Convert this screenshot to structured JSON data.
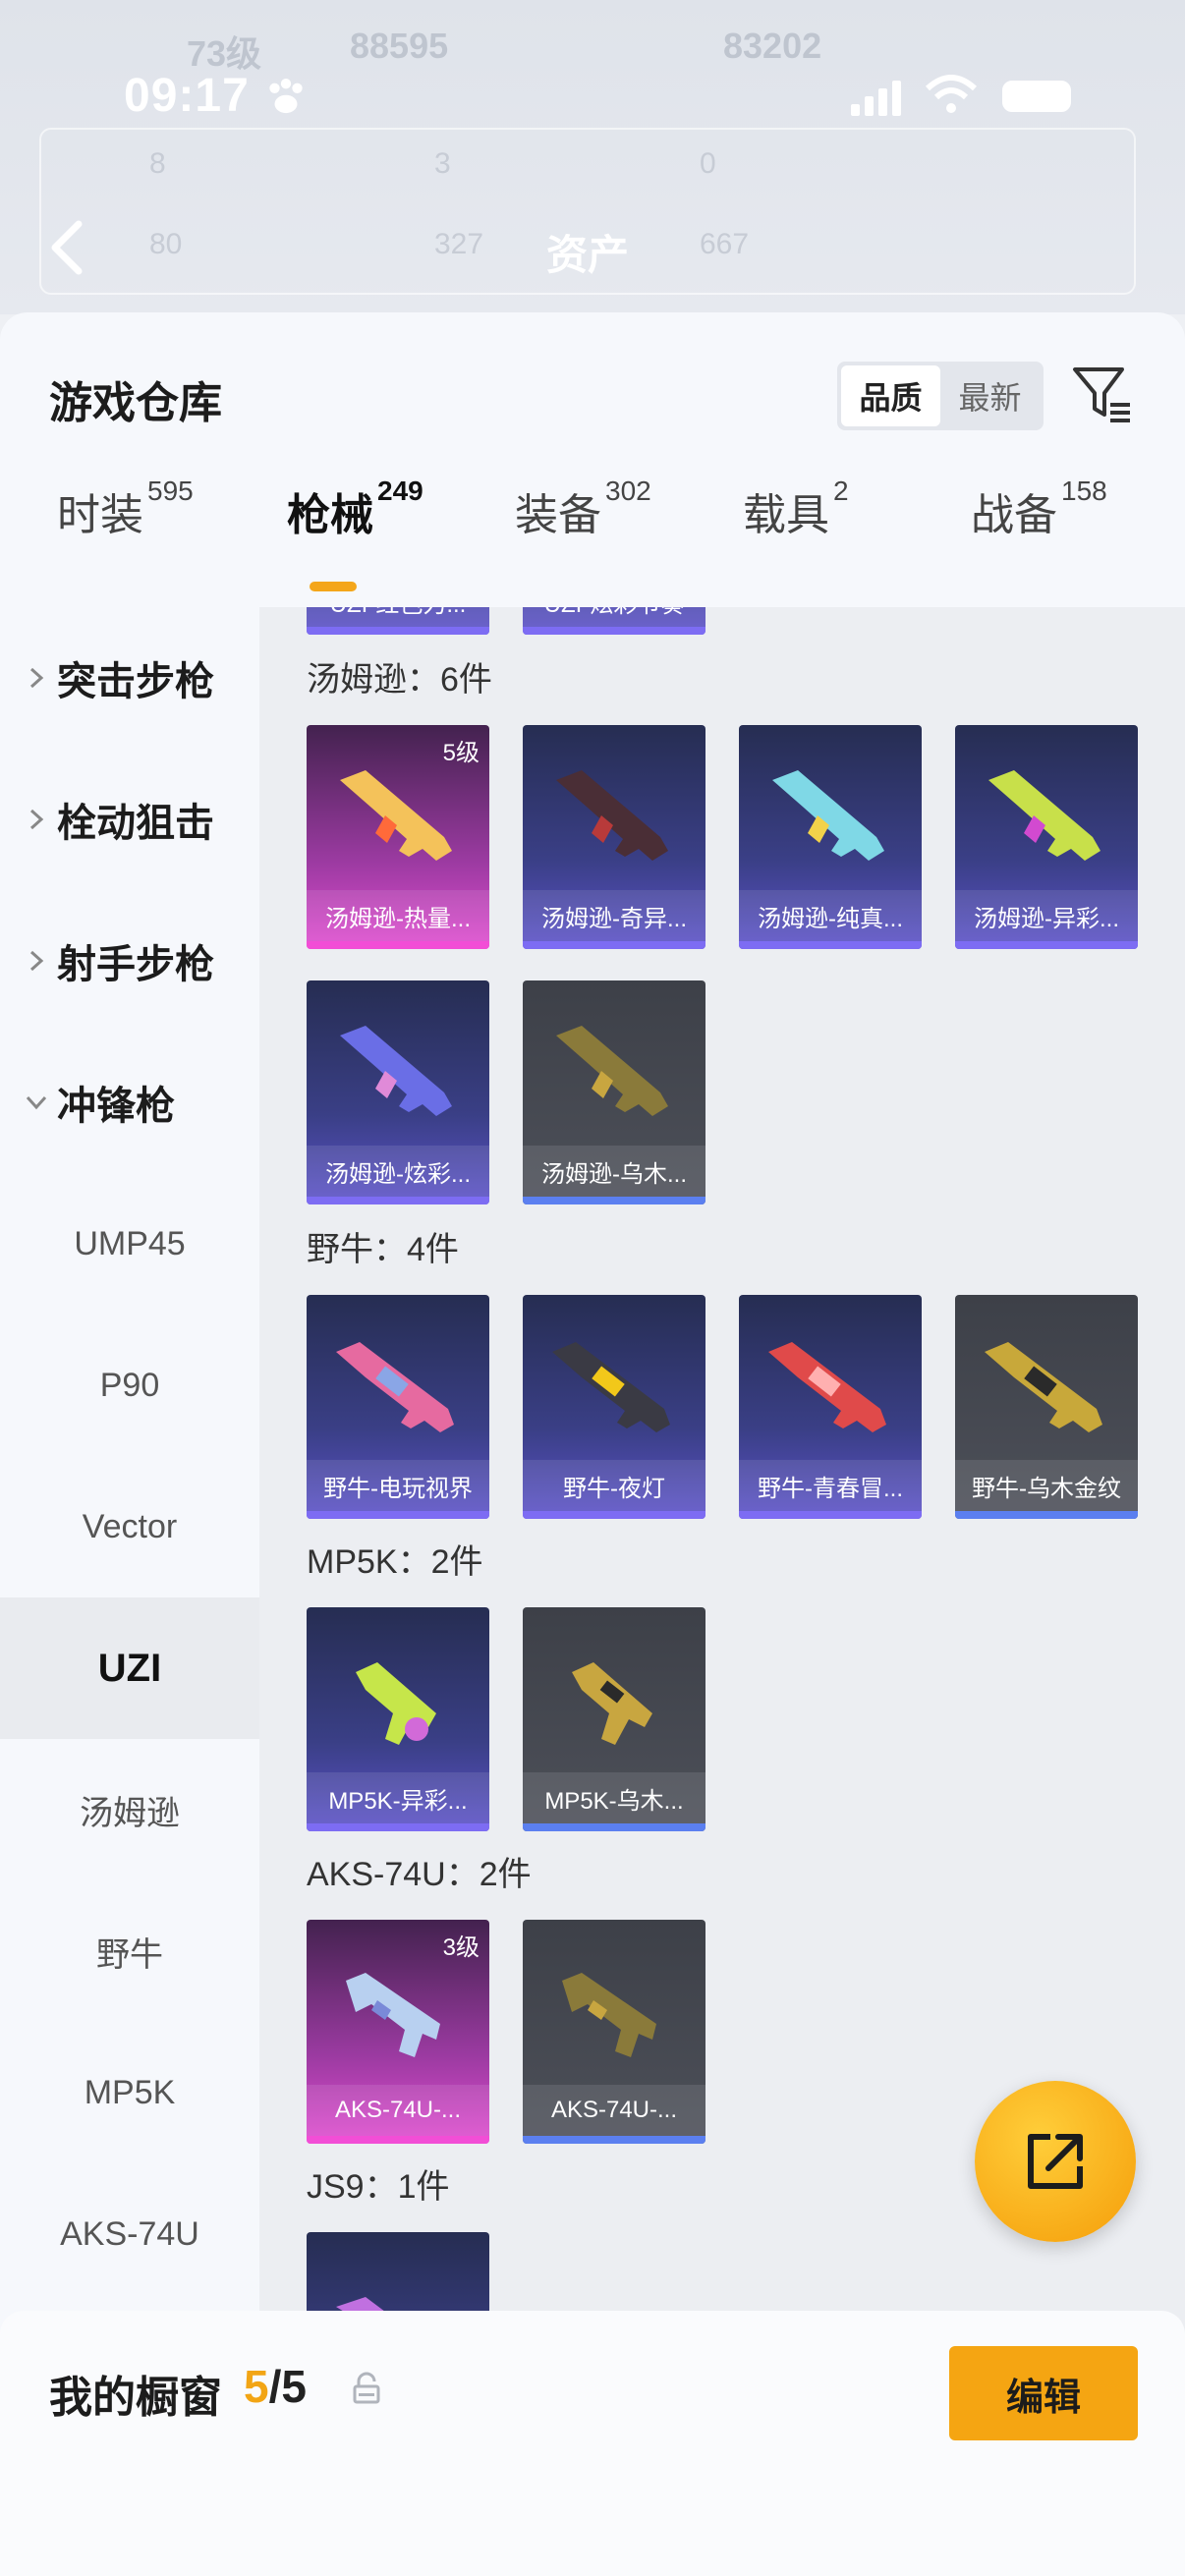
{
  "status_bar": {
    "time": "09:17"
  },
  "header_bg": {
    "title": "资产",
    "faded_top": [
      "73级",
      "88595",
      "83202"
    ],
    "faded_row1": [
      "8",
      "3",
      "0"
    ],
    "faded_row2": [
      "80",
      "327",
      "667"
    ]
  },
  "warehouse": {
    "title": "游戏仓库",
    "sort_options": [
      "品质",
      "最新"
    ],
    "sort_selected": "品质"
  },
  "tabs": [
    {
      "label": "时装",
      "count": "595"
    },
    {
      "label": "枪械",
      "count": "249"
    },
    {
      "label": "装备",
      "count": "302"
    },
    {
      "label": "载具",
      "count": "2"
    },
    {
      "label": "战备",
      "count": "158"
    }
  ],
  "sidebar": {
    "categories": [
      "突击步枪",
      "栓动狙击",
      "射手步枪",
      "冲锋枪"
    ],
    "sub_items": [
      "UMP45",
      "P90",
      "Vector",
      "UZI",
      "汤姆逊",
      "野牛",
      "MP5K",
      "AKS-74U"
    ]
  },
  "content": {
    "top_partial": [
      "UZI-红色力...",
      "UZI-炫彩节奏"
    ],
    "groups": [
      {
        "title": "汤姆逊：6件",
        "items": [
          {
            "name": "汤姆逊-热量...",
            "tier": "pink",
            "level": "5级"
          },
          {
            "name": "汤姆逊-奇异...",
            "tier": "purple"
          },
          {
            "name": "汤姆逊-纯真...",
            "tier": "purple"
          },
          {
            "name": "汤姆逊-异彩...",
            "tier": "purple"
          },
          {
            "name": "汤姆逊-炫彩...",
            "tier": "purple"
          },
          {
            "name": "汤姆逊-乌木...",
            "tier": "gray"
          }
        ]
      },
      {
        "title": "野牛：4件",
        "items": [
          {
            "name": "野牛-电玩视界",
            "tier": "purple"
          },
          {
            "name": "野牛-夜灯",
            "tier": "purple"
          },
          {
            "name": "野牛-青春冒...",
            "tier": "purple"
          },
          {
            "name": "野牛-乌木金纹",
            "tier": "gray"
          }
        ]
      },
      {
        "title": "MP5K：2件",
        "items": [
          {
            "name": "MP5K-异彩...",
            "tier": "purple"
          },
          {
            "name": "MP5K-乌木...",
            "tier": "gray"
          }
        ]
      },
      {
        "title": "AKS-74U：2件",
        "items": [
          {
            "name": "AKS-74U-...",
            "tier": "pink",
            "level": "3级"
          },
          {
            "name": "AKS-74U-...",
            "tier": "gray"
          }
        ]
      },
      {
        "title": "JS9：1件",
        "items": []
      }
    ]
  },
  "showcase": {
    "title": "我的橱窗",
    "current": "5",
    "total": "/5",
    "edit_label": "编辑"
  },
  "colors": {
    "accent": "#f5a512",
    "purple_tier": "#7d6cf3",
    "pink_tier": "#f24ed6",
    "gray_tier": "#5b7ff0"
  },
  "icons": [
    "paw-icon",
    "signal-icon",
    "wifi-icon",
    "battery-icon",
    "back-icon",
    "filter-icon",
    "chevron-right-icon",
    "chevron-down-icon",
    "share-icon",
    "lock-icon"
  ]
}
